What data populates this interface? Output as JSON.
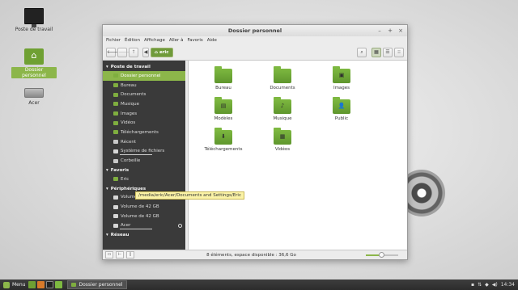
{
  "desktop": {
    "icons": [
      {
        "label": "Poste de travail",
        "icon": "computer-icon"
      },
      {
        "label": "Dossier personnel",
        "icon": "home-folder-icon"
      },
      {
        "label": "Acer",
        "icon": "drive-icon"
      }
    ]
  },
  "window": {
    "title": "Dossier personnel",
    "controls": [
      "–",
      "+",
      "×"
    ],
    "menu": [
      "Fichier",
      "Édition",
      "Affichage",
      "Aller à",
      "Favoris",
      "Aide"
    ],
    "toolbar": {
      "back": "🡐",
      "forward": "🡒",
      "up": "🡑",
      "crumb_prev": "◀",
      "crumb_label": "eric",
      "search": "⌕",
      "view_icons": "▦",
      "view_list": "☰",
      "view_compact": "⁝⁝"
    }
  },
  "sidebar": {
    "sections": [
      {
        "title": "Poste de travail",
        "items": [
          "Dossier personnel",
          "Bureau",
          "Documents",
          "Musique",
          "Images",
          "Vidéos",
          "Téléchargements",
          "Récent",
          "Système de fichiers",
          "Corbeille"
        ]
      },
      {
        "title": "Favoris",
        "items": [
          "Eric"
        ]
      },
      {
        "title": "Périphériques",
        "items": [
          "Volume de 22 GB",
          "Volume de 42 GB",
          "Volume de 42 GB",
          "Acer"
        ]
      },
      {
        "title": "Réseau",
        "items": []
      }
    ]
  },
  "main": {
    "items": [
      {
        "label": "Bureau",
        "glyph": ""
      },
      {
        "label": "Documents",
        "glyph": ""
      },
      {
        "label": "Images",
        "glyph": "▣"
      },
      {
        "label": "Modèles",
        "glyph": "▤"
      },
      {
        "label": "Musique",
        "glyph": "♪"
      },
      {
        "label": "Public",
        "glyph": "👤"
      },
      {
        "label": "Téléchargements",
        "glyph": "⬇"
      },
      {
        "label": "Vidéos",
        "glyph": "▦"
      }
    ]
  },
  "tooltip": "/media/eric/Acer/Documents and Settings/Eric",
  "status": {
    "text": "8 éléments, espace disponible : 36,6 Go",
    "zoom_level": 0.5
  },
  "taskbar": {
    "menu_label": "Menu",
    "task_label": "Dossier personnel",
    "clock": "14:34"
  },
  "colors": {
    "accent": "#8cb64a",
    "sidebar_bg": "#3a3a3a"
  }
}
